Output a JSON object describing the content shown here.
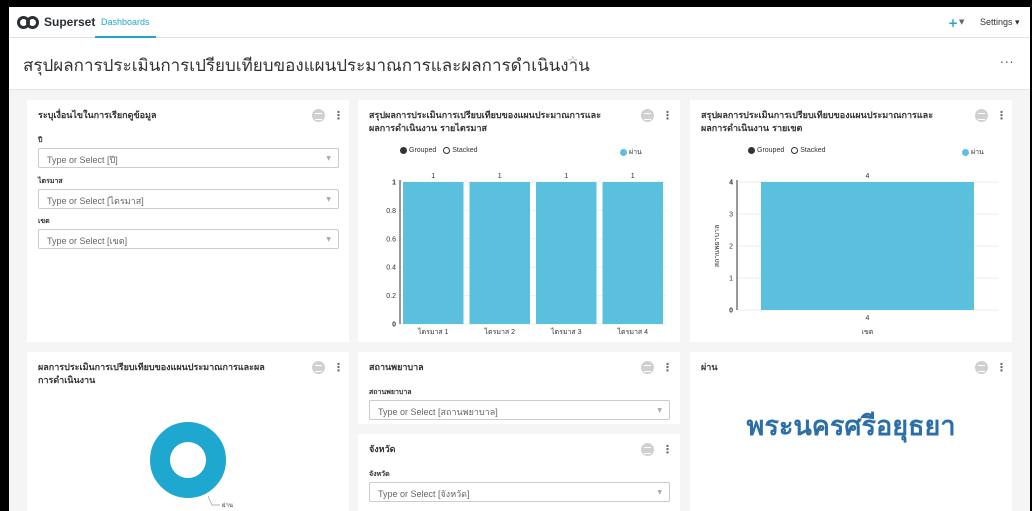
{
  "nav": {
    "brand": "Superset",
    "tab": "Dashboards",
    "plus": "+",
    "settings": "Settings ▾"
  },
  "header": {
    "title": "สรุปผลการประเมินการเปรียบเทียบของแผนประมาณการและผลการดำเนินงาน",
    "more": "..."
  },
  "colors": {
    "accent": "#20a7c9",
    "bar": "#5bc0de",
    "donut": "#1fa8cf",
    "big_text": "#2b6fa8"
  },
  "filter_card": {
    "title": "ระบุเงื่อนไขในการเรียกดูข้อมูล",
    "fields": [
      {
        "label": "ปี",
        "placeholder": "Type or Select [ปี]"
      },
      {
        "label": "ไตรมาส",
        "placeholder": "Type or Select [ไตรมาส]"
      },
      {
        "label": "เขต",
        "placeholder": "Type or Select [เขต]"
      }
    ]
  },
  "chart_quarter": {
    "title_line1": "สรุปผลการประเมินการเปรียบเทียบของแผนประมาณการและ",
    "title_line2": "ผลการดำเนินงาน รายไตรมาส",
    "legend": {
      "grouped": "Grouped",
      "stacked": "Stacked",
      "series": "ผ่าน"
    }
  },
  "chart_zone": {
    "title_line1": "สรุปผลการประเมินการเปรียบเทียบของแผนประมาณการและ",
    "title_line2": "ผลการดำเนินงาน รายเขต",
    "legend": {
      "grouped": "Grouped",
      "stacked": "Stacked",
      "series": "ผ่าน"
    }
  },
  "donut_card": {
    "title_line1": "ผลการประเมินการเปรียบเทียบของแผนประมาณการและผล",
    "title_line2": "การดำเนินงาน",
    "label": "ผ่าน"
  },
  "hospital_card": {
    "title": "สถานพยาบาล",
    "field_label": "สถานพยาบาล",
    "placeholder": "Type or Select [สถานพยาบาล]"
  },
  "province_card": {
    "title": "จังหวัด",
    "field_label": "จังหวัด",
    "placeholder": "Type or Select [จังหวัด]"
  },
  "big_number_card": {
    "title": "ผ่าน",
    "value": "พระนครศรีอยุธยา"
  },
  "chart_data": [
    {
      "type": "bar",
      "categories": [
        "ไตรมาส 1",
        "ไตรมาส 2",
        "ไตรมาส 3",
        "ไตรมาส 4"
      ],
      "series": [
        {
          "name": "ผ่าน",
          "values": [
            1,
            1,
            1,
            1
          ]
        }
      ],
      "ylim": [
        0,
        1
      ],
      "yticks": [
        "0",
        "0.2",
        "0.4",
        "0.6",
        "0.8",
        "1"
      ],
      "xlabel": "",
      "ylabel": ""
    },
    {
      "type": "bar",
      "categories": [
        "4"
      ],
      "series": [
        {
          "name": "ผ่าน",
          "values": [
            4
          ]
        }
      ],
      "ylim": [
        0,
        4
      ],
      "yticks": [
        "0",
        "1",
        "2",
        "3",
        "4"
      ],
      "xlabel": "เขต",
      "ylabel": "สถานพยาบาล"
    },
    {
      "type": "pie",
      "categories": [
        "ผ่าน"
      ],
      "values": [
        1
      ]
    }
  ]
}
